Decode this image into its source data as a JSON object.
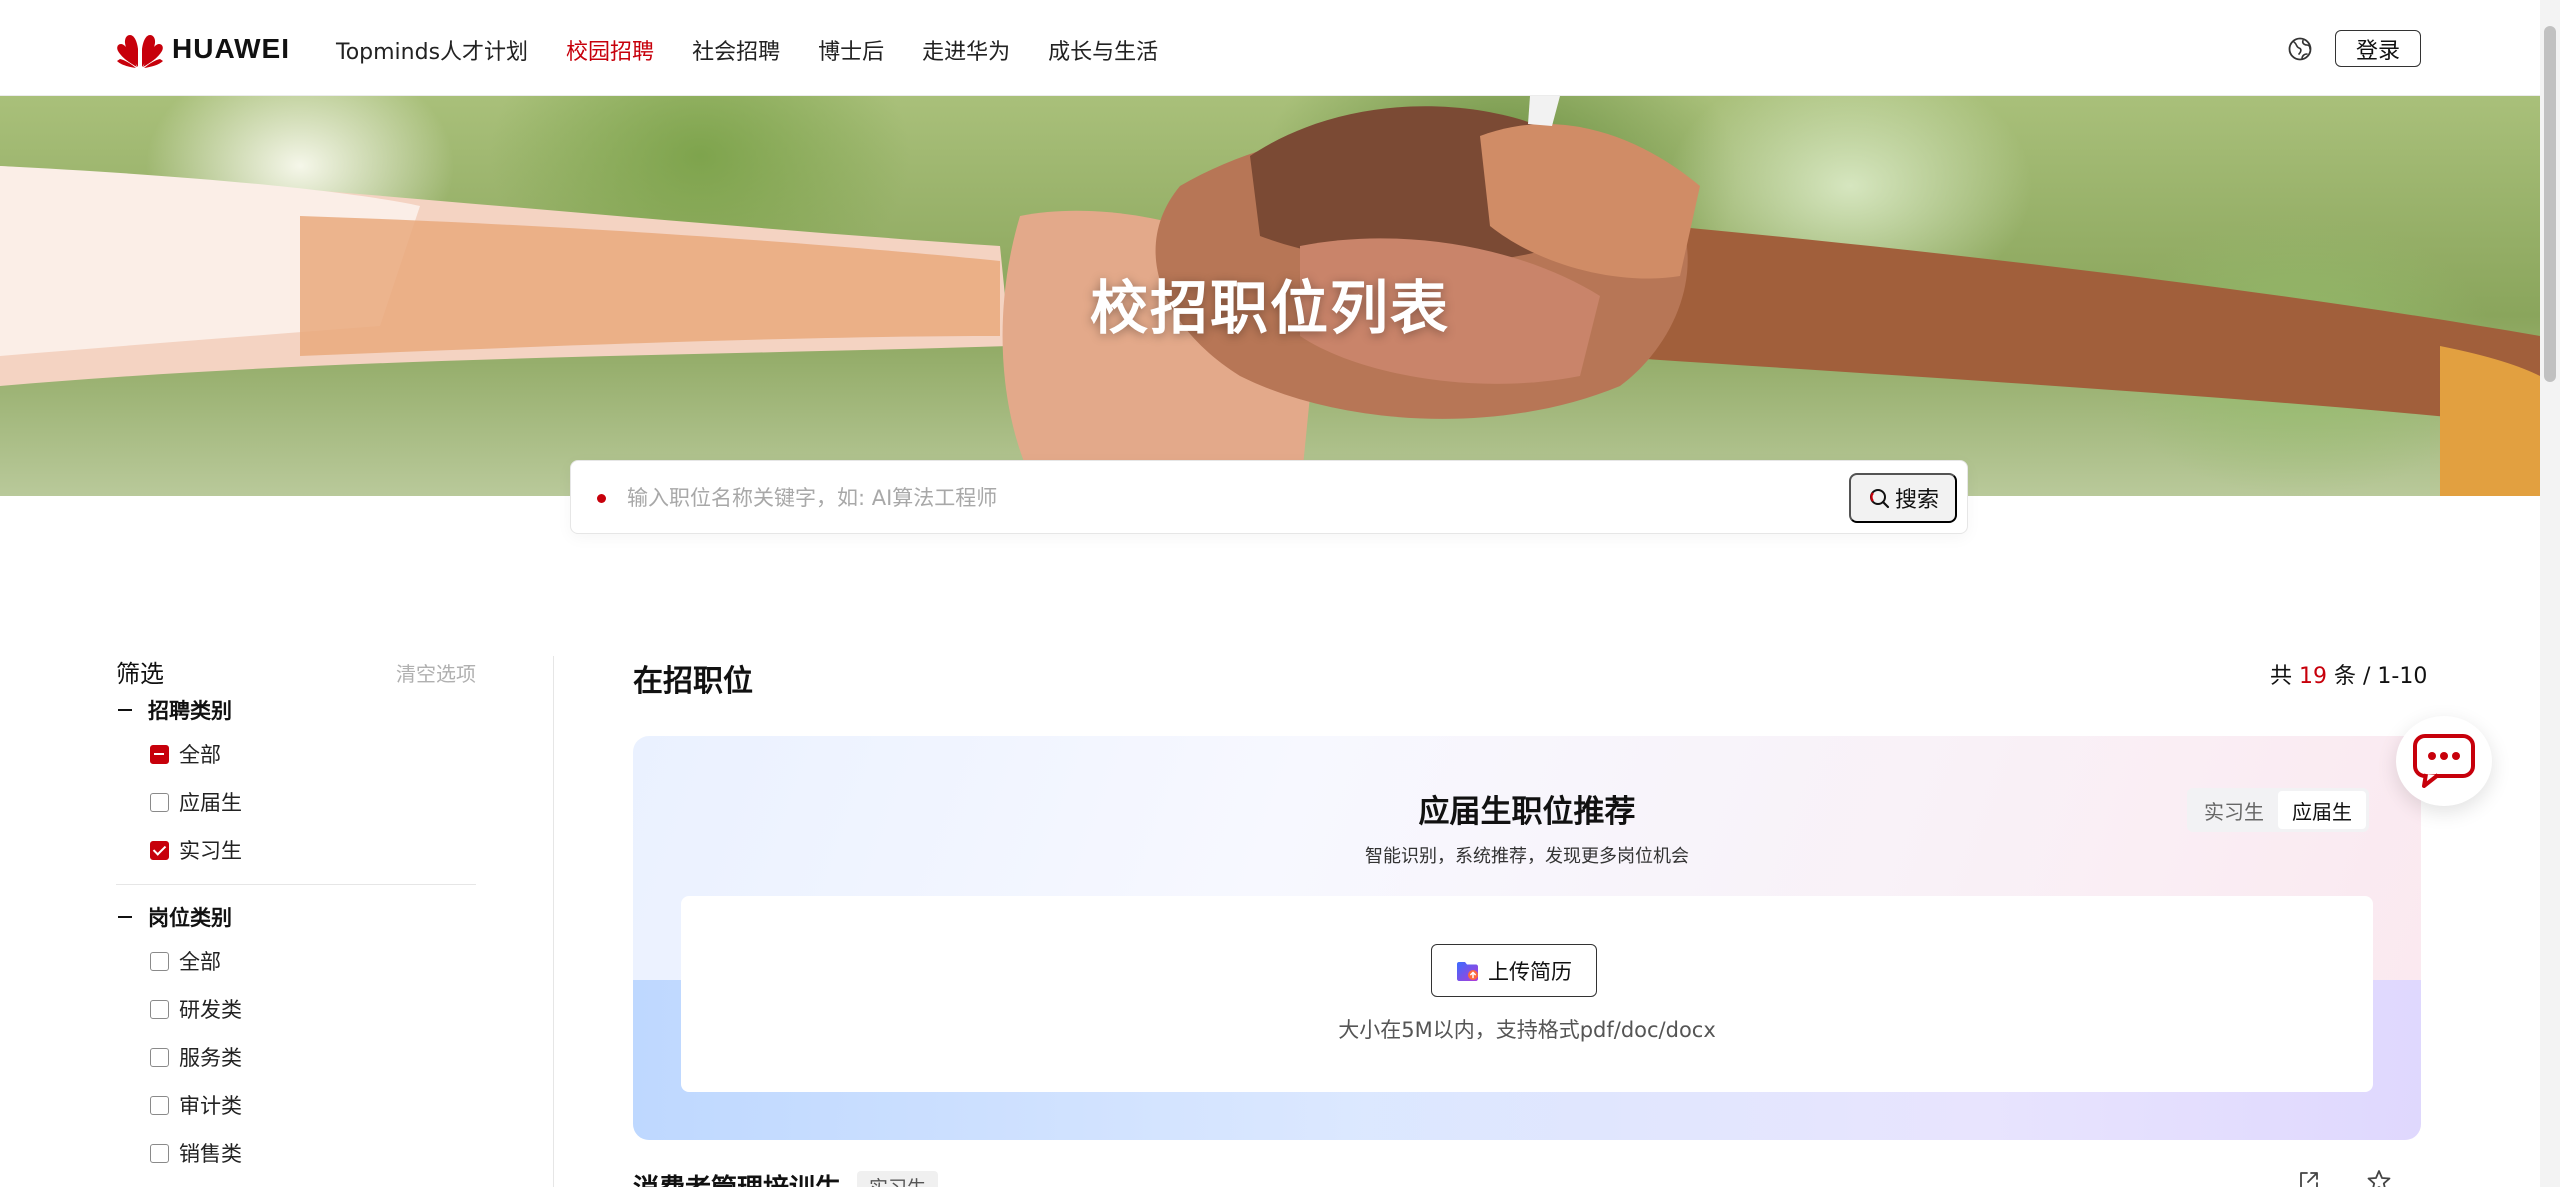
{
  "header": {
    "brand": "HUAWEI",
    "nav": [
      {
        "label": "Topminds人才计划",
        "active": false
      },
      {
        "label": "校园招聘",
        "active": true
      },
      {
        "label": "社会招聘",
        "active": false
      },
      {
        "label": "博士后",
        "active": false
      },
      {
        "label": "走进华为",
        "active": false
      },
      {
        "label": "成长与生活",
        "active": false
      }
    ],
    "login_label": "登录"
  },
  "hero": {
    "title": "校招职位列表"
  },
  "search": {
    "placeholder": "输入职位名称关键字，如: AI算法工程师",
    "button_label": "搜索"
  },
  "filters": {
    "title": "筛选",
    "clear_label": "清空选项",
    "groups": [
      {
        "title": "招聘类别",
        "options": [
          {
            "label": "全部",
            "state": "partial"
          },
          {
            "label": "应届生",
            "state": "unchecked"
          },
          {
            "label": "实习生",
            "state": "checked"
          }
        ]
      },
      {
        "title": "岗位类别",
        "options": [
          {
            "label": "全部",
            "state": "unchecked"
          },
          {
            "label": "研发类",
            "state": "unchecked"
          },
          {
            "label": "服务类",
            "state": "unchecked"
          },
          {
            "label": "审计类",
            "state": "unchecked"
          },
          {
            "label": "销售类",
            "state": "unchecked"
          }
        ]
      }
    ]
  },
  "main": {
    "title": "在招职位",
    "count_prefix": "共",
    "count_total": "19",
    "count_suffix": "条 / 1-10",
    "recommend": {
      "title": "应届生职位推荐",
      "subtitle": "智能识别，系统推荐，发现更多岗位机会",
      "toggle": [
        {
          "label": "实习生",
          "active": false
        },
        {
          "label": "应届生",
          "active": true
        }
      ],
      "upload_label": "上传简历",
      "upload_hint": "大小在5M以内，支持格式pdf/doc/docx"
    },
    "first_job": {
      "title": "消费者管理培训生",
      "tag": "实习生"
    }
  },
  "colors": {
    "brand_red": "#c7000b",
    "text": "#1a1a1a",
    "muted": "#b0b0b0"
  },
  "icons": [
    "huawei-logo-icon",
    "globe-icon",
    "search-icon",
    "upload-folder-icon",
    "share-icon",
    "star-icon",
    "chat-icon"
  ]
}
